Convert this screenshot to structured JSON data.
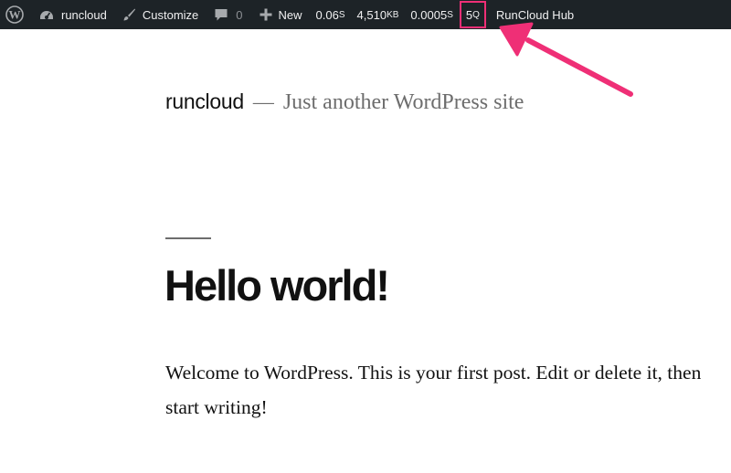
{
  "admin_bar": {
    "wp_logo_icon": "wordpress-logo-icon",
    "site_name": "runcloud",
    "site_icon": "dashboard-icon",
    "customize_label": "Customize",
    "customize_icon": "paintbrush-icon",
    "comments_count": "0",
    "comments_icon": "comment-bubble-icon",
    "new_label": "New",
    "new_icon": "plus-icon",
    "query_monitor": {
      "time_value": "0.06",
      "time_unit": "S",
      "memory_value": "4,510",
      "memory_unit": "KB",
      "db_time_value": "0.0005",
      "db_time_unit": "S",
      "queries_value": "5",
      "queries_unit": "Q"
    },
    "hub_label": "RunCloud Hub"
  },
  "highlight": {
    "color": "#ef2f76"
  },
  "site": {
    "title": "runcloud",
    "separator": "—",
    "description": "Just another WordPress site"
  },
  "post": {
    "title": "Hello world!",
    "body": "Welcome to WordPress. This is your first post. Edit or delete it, then start writing!"
  },
  "colors": {
    "admin_bar_bg": "#1d2327",
    "admin_bar_text": "#f0f0f1",
    "muted_text": "#6d6d6d",
    "accent": "#ef2f76"
  }
}
